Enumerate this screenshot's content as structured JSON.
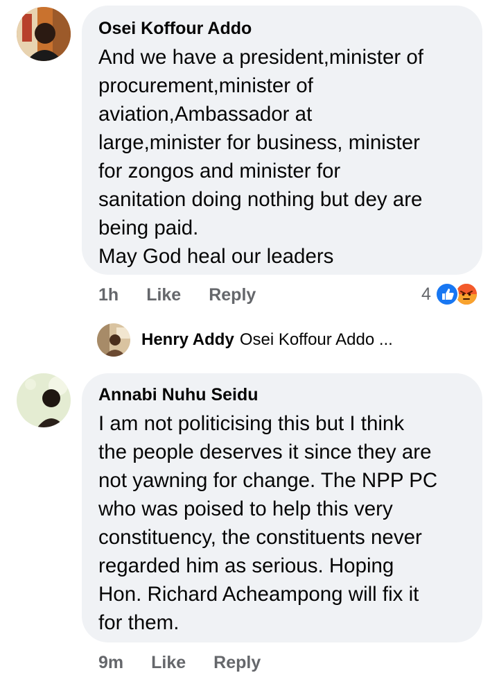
{
  "comments": [
    {
      "author": "Osei Koffour Addo",
      "text": "And we have a president,minister of\nprocurement,minister of\naviation,Ambassador at\nlarge,minister for business, minister\nfor zongos and minister for\nsanitation doing nothing but dey are\nbeing paid.\nMay God heal our leaders",
      "time": "1h",
      "like_label": "Like",
      "reply_label": "Reply",
      "reaction_count": "4",
      "reactions": [
        "like-icon",
        "angry-icon"
      ],
      "reply_preview": {
        "author": "Henry Addy",
        "text": "Osei Koffour Addo ..."
      }
    },
    {
      "author": "Annabi Nuhu Seidu",
      "text": "I am not politicising this but I think\nthe people deserves it since they are\nnot yawning for change. The NPP PC\nwho was poised to help this very\nconstituency, the constituents never\nregarded him as serious. Hoping\nHon. Richard Acheampong will fix it\nfor them.",
      "time": "9m",
      "like_label": "Like",
      "reply_label": "Reply"
    }
  ],
  "colors": {
    "bubble": "#f0f2f5",
    "meta_text": "#65676b",
    "like_blue": "#1877f2",
    "angry_orange": "#f7714c"
  }
}
